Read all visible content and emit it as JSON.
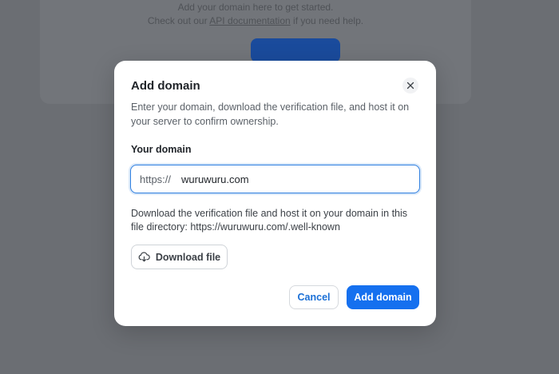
{
  "background": {
    "line1": "Add your domain here to get started.",
    "line2_prefix": "Check out our",
    "line2_link": "API documentation",
    "line2_suffix": "if you need help."
  },
  "modal": {
    "title": "Add domain",
    "description": "Enter your domain, download the verification file, and host it on your server to confirm ownership.",
    "field_label": "Your domain",
    "input_prefix": "https://",
    "input_value": "wuruwuru.com",
    "download_info": "Download the verification file and host it on your domain in this file directory: https://wuruwuru.com/.well-known",
    "download_label": "Download file",
    "cancel_label": "Cancel",
    "submit_label": "Add domain"
  },
  "icons": {
    "close": "close-icon",
    "download": "cloud-download-icon"
  },
  "colors": {
    "accent": "#1570ef",
    "focus_border": "#2f7fe0",
    "backdrop": "#6b6e73"
  }
}
